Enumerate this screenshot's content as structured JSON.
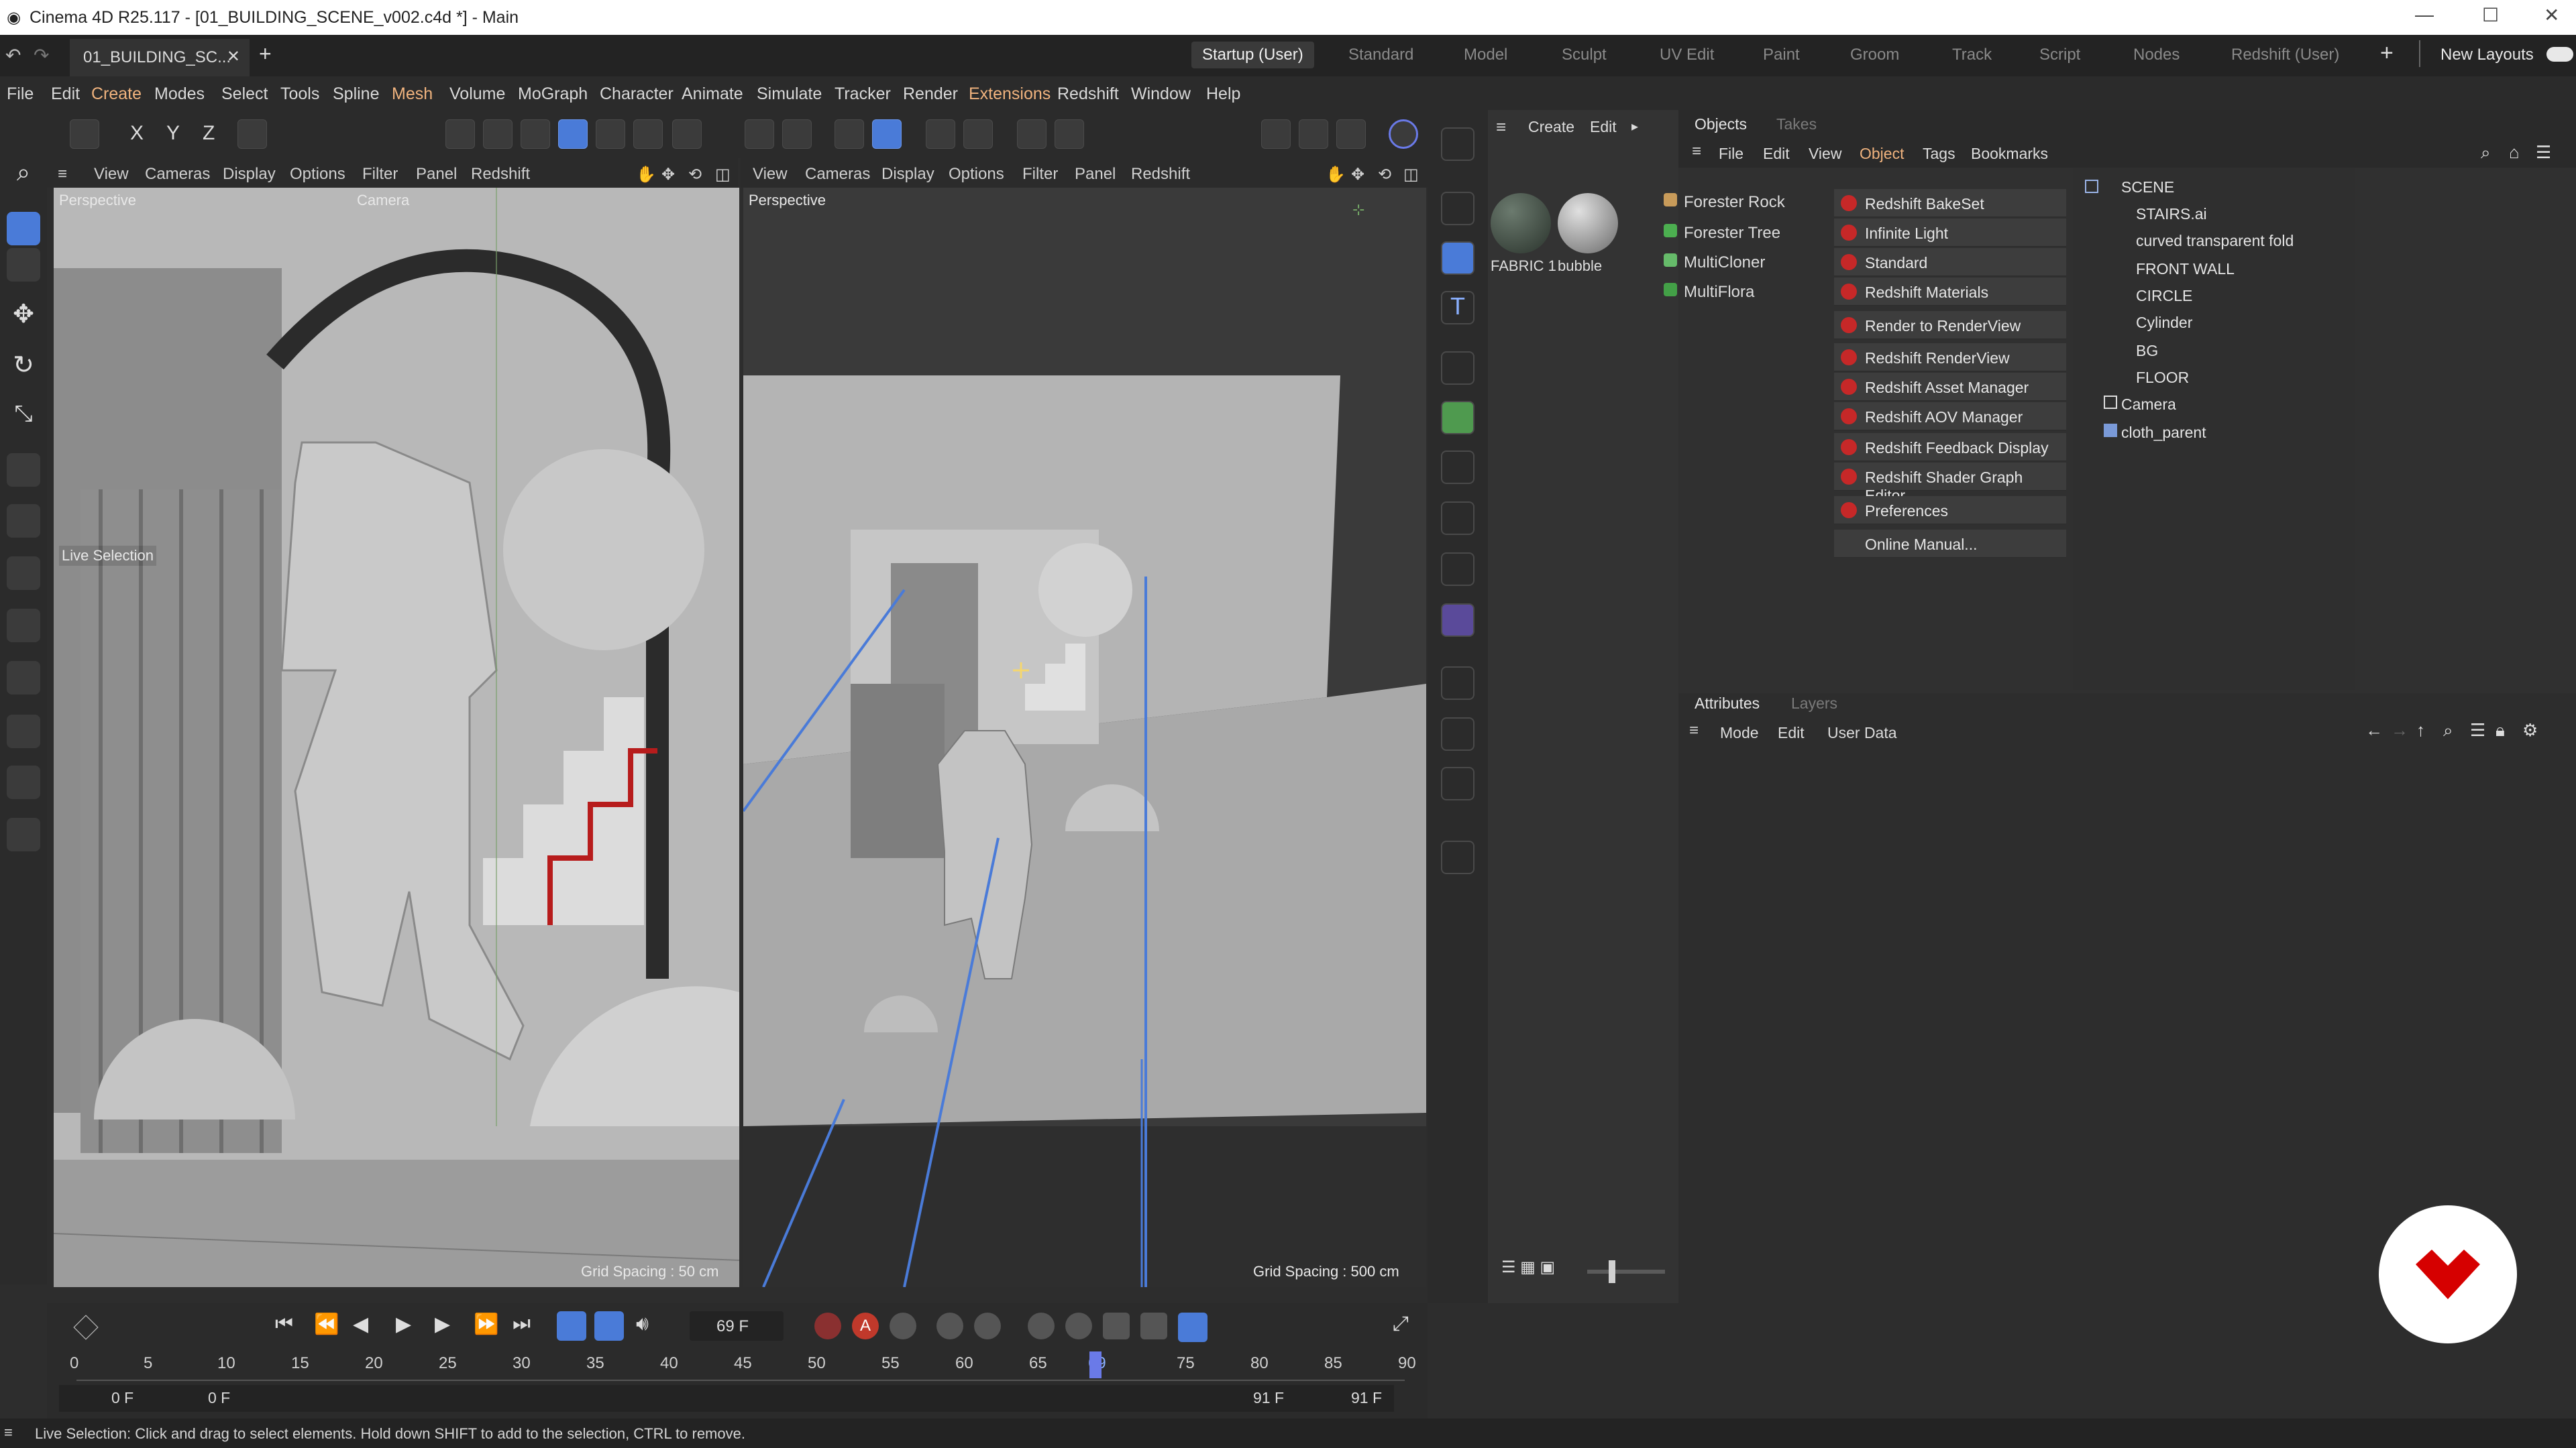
{
  "window": {
    "title": "Cinema 4D R25.117 - [01_BUILDING_SCENE_v002.c4d *] - Main"
  },
  "doc_tab": {
    "label": "01_BUILDING_SC..."
  },
  "layouts": {
    "tabs": [
      "Startup (User)",
      "Standard",
      "Model",
      "Sculpt",
      "UV Edit",
      "Paint",
      "Groom",
      "Track",
      "Script",
      "Nodes",
      "Redshift (User)"
    ],
    "new_layouts": "New Layouts"
  },
  "menu": [
    "File",
    "Edit",
    "Create",
    "Modes",
    "Select",
    "Tools",
    "Spline",
    "Mesh",
    "Volume",
    "MoGraph",
    "Character",
    "Animate",
    "Simulate",
    "Tracker",
    "Render",
    "Extensions",
    "Redshift",
    "Window",
    "Help"
  ],
  "axis_buttons": [
    "X",
    "Y",
    "Z"
  ],
  "viewport_menu": [
    "View",
    "Cameras",
    "Display",
    "Options",
    "Filter",
    "Panel",
    "Redshift"
  ],
  "viewport_left": {
    "label": "Perspective",
    "camera": "Camera",
    "grid": "Grid Spacing : 50 cm",
    "tool_label": "Live Selection"
  },
  "viewport_right": {
    "label": "Perspective",
    "grid": "Grid Spacing : 500 cm"
  },
  "materials_menu": [
    "Create",
    "Edit"
  ],
  "materials": [
    "FABRIC 1",
    "bubble"
  ],
  "plugins": [
    "Forester Rock",
    "Forester Tree",
    "MultiCloner",
    "MultiFlora"
  ],
  "redshift_menu": [
    "Redshift BakeSet",
    "Infinite Light",
    "Standard",
    "Redshift Materials",
    "Render to RenderView",
    "Redshift RenderView",
    "Redshift Asset Manager",
    "Redshift AOV Manager",
    "Redshift Feedback Display",
    "Redshift Shader Graph Editor",
    "Preferences",
    "Online Manual..."
  ],
  "objects_panel": {
    "tabs": [
      "Objects",
      "Takes"
    ],
    "menu": [
      "File",
      "Edit",
      "View",
      "Object",
      "Tags",
      "Bookmarks"
    ],
    "tree": [
      "SCENE",
      "STAIRS.ai",
      "curved transparent fold",
      "FRONT WALL",
      "CIRCLE",
      "Cylinder",
      "BG",
      "FLOOR",
      "Camera",
      "cloth_parent"
    ]
  },
  "attributes_panel": {
    "tabs": [
      "Attributes",
      "Layers"
    ],
    "menu": [
      "Mode",
      "Edit",
      "User Data"
    ]
  },
  "timeline": {
    "current_frame": "69 F",
    "ticks": [
      "0",
      "5",
      "10",
      "15",
      "20",
      "25",
      "30",
      "35",
      "40",
      "45",
      "50",
      "55",
      "60",
      "65",
      "69",
      "75",
      "80",
      "85",
      "90"
    ],
    "start": "0 F",
    "start2": "0 F",
    "end": "91 F",
    "end2": "91 F",
    "playhead_frame": 69,
    "frame_max": 90
  },
  "status": {
    "text": "Live Selection: Click and drag to select elements. Hold down SHIFT to add to the selection, CTRL to remove."
  },
  "colors": {
    "accent": "#4a7bd8",
    "redshift": "#c62828",
    "brand": "#d60000"
  }
}
